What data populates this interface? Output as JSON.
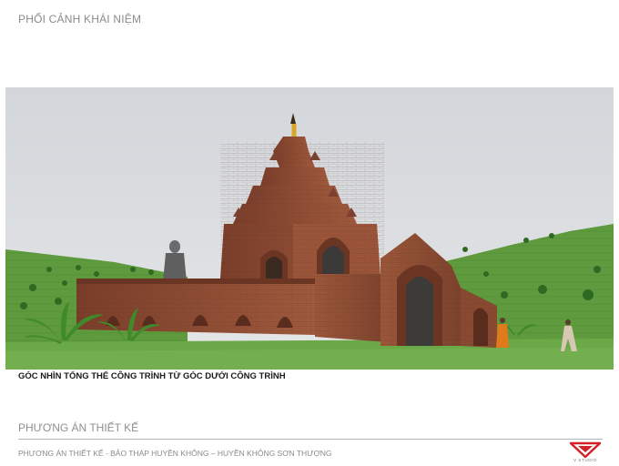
{
  "header": {
    "title": "PHỐI CẢNH KHÁI NIỆM"
  },
  "render": {
    "caption": "GÓC NHÌN TỔNG THỂ CÔNG TRÌNH TỪ GÓC DƯỚI CÔNG TRÌNH"
  },
  "footer": {
    "section_title": "PHƯƠNG ÁN THIẾT KẾ",
    "project_name": "PHƯƠNG ÁN THIẾT KẾ - BẢO THÁP HUYỀN KHÔNG – HUYỀN KHÔNG SƠN THƯỢNG",
    "logo_text": "V STUDIO"
  },
  "colors": {
    "logo_red": "#d42027",
    "brick": "#8a4a32",
    "grass": "#5e9a3c",
    "sky": "#d9dcdf"
  }
}
